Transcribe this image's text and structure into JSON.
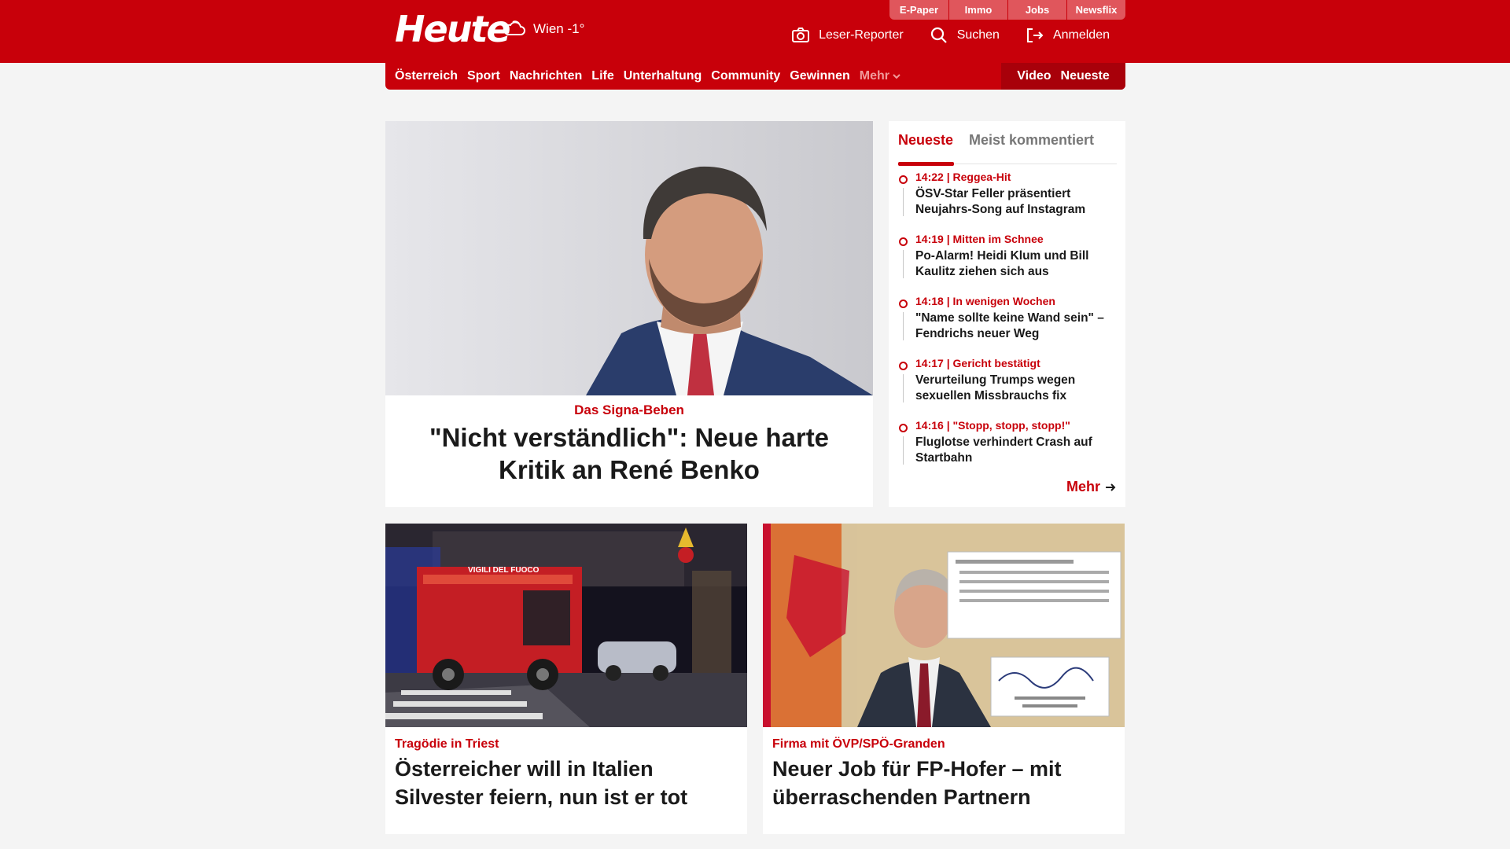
{
  "header": {
    "logo": "Heute",
    "weather": "Wien -1°",
    "top_tabs": [
      "E-Paper",
      "Immo",
      "Jobs",
      "Newsflix"
    ],
    "actions": [
      {
        "label": "Leser-Reporter",
        "icon": "camera-icon"
      },
      {
        "label": "Suchen",
        "icon": "search-icon"
      },
      {
        "label": "Anmelden",
        "icon": "login-icon"
      }
    ]
  },
  "nav": {
    "items": [
      "Österreich",
      "Sport",
      "Nachrichten",
      "Life",
      "Unterhaltung",
      "Community",
      "Gewinnen"
    ],
    "more": "Mehr",
    "right": [
      "Video",
      "Neueste"
    ]
  },
  "hero": {
    "kicker": "Das Signa-Beben",
    "title": "\"Nicht verständlich\": Neue harte Kritik an René Benko"
  },
  "sidebar": {
    "tabs": [
      "Neueste",
      "Meist kommentiert"
    ],
    "items": [
      {
        "time": "14:22",
        "topic": "Reggea-Hit",
        "title": "ÖSV-Star Feller präsentiert Neujahrs-Song auf Instagram"
      },
      {
        "time": "14:19",
        "topic": "Mitten im Schnee",
        "title": "Po-Alarm! Heidi Klum und Bill Kaulitz ziehen sich aus"
      },
      {
        "time": "14:18",
        "topic": "In wenigen Wochen",
        "title": "\"Name sollte keine Wand sein\" – Fendrichs neuer Weg"
      },
      {
        "time": "14:17",
        "topic": "Gericht bestätigt",
        "title": "Verurteilung Trumps wegen sexuellen Missbrauchs fix"
      },
      {
        "time": "14:16",
        "topic": "\"Stopp, stopp, stopp!\"",
        "title": "Fluglotse verhindert Crash auf Startbahn"
      }
    ],
    "more": "Mehr"
  },
  "cards": [
    {
      "kicker": "Tragödie in Triest",
      "title": "Österreicher will in Italien Silvester feiern, nun ist er tot",
      "image_text": "VIGILI DEL FUOCO"
    },
    {
      "kicker": "Firma mit ÖVP/SPÖ-Granden",
      "title": "Neuer Job für FP-Hofer – mit überraschenden Partnern"
    }
  ],
  "colors": {
    "brand": "#c8000a",
    "brand_dark": "#a8000a"
  }
}
